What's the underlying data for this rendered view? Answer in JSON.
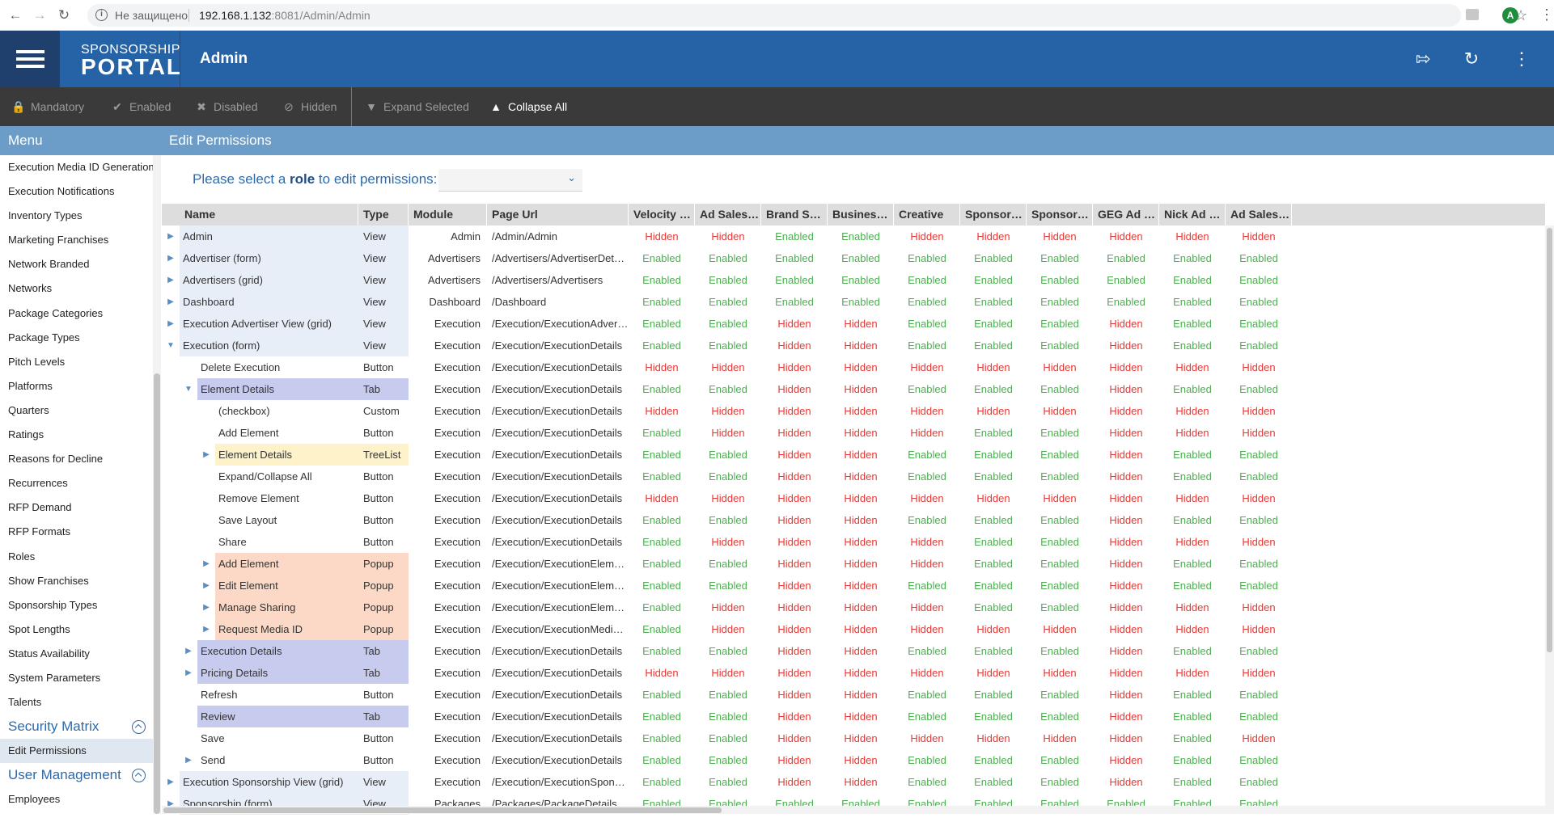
{
  "browser": {
    "insecure_label": "Не защищено",
    "url_host": "192.168.1.132",
    "url_rest": ":8081/Admin/Admin",
    "profile_initial": "A"
  },
  "header": {
    "logo_line1": "SPONSORSHIP",
    "logo_line2": "PORTAL",
    "title": "Admin",
    "brand_color": "#2563a6"
  },
  "toolbar": {
    "mandatory": "Mandatory",
    "enabled": "Enabled",
    "disabled": "Disabled",
    "hidden": "Hidden",
    "expand_selected": "Expand Selected",
    "collapse_all": "Collapse All"
  },
  "menu": {
    "title": "Menu",
    "items": [
      {
        "label": "Execution Media ID Generation"
      },
      {
        "label": "Execution Notifications"
      },
      {
        "label": "Inventory Types"
      },
      {
        "label": "Marketing Franchises"
      },
      {
        "label": "Network Branded"
      },
      {
        "label": "Networks"
      },
      {
        "label": "Package Categories"
      },
      {
        "label": "Package Types"
      },
      {
        "label": "Pitch Levels"
      },
      {
        "label": "Platforms"
      },
      {
        "label": "Quarters"
      },
      {
        "label": "Ratings"
      },
      {
        "label": "Reasons for Decline"
      },
      {
        "label": "Recurrences"
      },
      {
        "label": "RFP Demand"
      },
      {
        "label": "RFP Formats"
      },
      {
        "label": "Roles"
      },
      {
        "label": "Show Franchises"
      },
      {
        "label": "Sponsorship Types"
      },
      {
        "label": "Spot Lengths"
      },
      {
        "label": "Status Availability"
      },
      {
        "label": "System Parameters"
      },
      {
        "label": "Talents"
      },
      {
        "label": "Security Matrix",
        "section": true
      },
      {
        "label": "Edit Permissions",
        "selected": true
      },
      {
        "label": "User Management",
        "section": true
      },
      {
        "label": "Employees"
      }
    ]
  },
  "content": {
    "title": "Edit Permissions",
    "role_prompt_prefix": "Please select a ",
    "role_prompt_bold": "role",
    "role_prompt_suffix": " to edit permissions:",
    "role_value": ""
  },
  "grid": {
    "columns": [
      "Name",
      "Type",
      "Module",
      "Page Url",
      "Velocity Ex...",
      "Ad Sales A...",
      "Brand Sales",
      "Business A...",
      "Creative",
      "Sponsorshi...",
      "Sponsorshi...",
      "GEG Ad Sal...",
      "Nick Ad Sal...",
      "Ad Sales SSE"
    ],
    "colors": {
      "enabled": "#4caf50",
      "hidden": "#e53935"
    },
    "rows": [
      {
        "name": "Admin",
        "type": "View",
        "module": "Admin",
        "url": "/Admin/Admin",
        "level": 0,
        "expander": "right",
        "hl": "view",
        "perms": [
          "Hidden",
          "Hidden",
          "Enabled",
          "Enabled",
          "Hidden",
          "Hidden",
          "Hidden",
          "Hidden",
          "Hidden",
          "Hidden"
        ]
      },
      {
        "name": "Advertiser (form)",
        "type": "View",
        "module": "Advertisers",
        "url": "/Advertisers/AdvertiserDetails",
        "level": 0,
        "expander": "right",
        "hl": "view",
        "perms": [
          "Enabled",
          "Enabled",
          "Enabled",
          "Enabled",
          "Enabled",
          "Enabled",
          "Enabled",
          "Enabled",
          "Enabled",
          "Enabled"
        ]
      },
      {
        "name": "Advertisers (grid)",
        "type": "View",
        "module": "Advertisers",
        "url": "/Advertisers/Advertisers",
        "level": 0,
        "expander": "right",
        "hl": "view",
        "perms": [
          "Enabled",
          "Enabled",
          "Enabled",
          "Enabled",
          "Enabled",
          "Enabled",
          "Enabled",
          "Enabled",
          "Enabled",
          "Enabled"
        ]
      },
      {
        "name": "Dashboard",
        "type": "View",
        "module": "Dashboard",
        "url": "/Dashboard",
        "level": 0,
        "expander": "right",
        "hl": "view",
        "perms": [
          "Enabled",
          "Enabled",
          "Enabled",
          "Enabled",
          "Enabled",
          "Enabled",
          "Enabled",
          "Enabled",
          "Enabled",
          "Enabled"
        ]
      },
      {
        "name": "Execution Advertiser View (grid)",
        "type": "View",
        "module": "Execution",
        "url": "/Execution/ExecutionAdvertiser",
        "level": 0,
        "expander": "right",
        "hl": "view",
        "perms": [
          "Enabled",
          "Enabled",
          "Hidden",
          "Hidden",
          "Enabled",
          "Enabled",
          "Enabled",
          "Hidden",
          "Enabled",
          "Enabled"
        ]
      },
      {
        "name": "Execution (form)",
        "type": "View",
        "module": "Execution",
        "url": "/Execution/ExecutionDetails",
        "level": 0,
        "expander": "down",
        "hl": "view",
        "perms": [
          "Enabled",
          "Enabled",
          "Hidden",
          "Hidden",
          "Enabled",
          "Enabled",
          "Enabled",
          "Hidden",
          "Enabled",
          "Enabled"
        ]
      },
      {
        "name": "Delete Execution",
        "type": "Button",
        "module": "Execution",
        "url": "/Execution/ExecutionDetails",
        "level": 1,
        "expander": "",
        "hl": "",
        "perms": [
          "Hidden",
          "Hidden",
          "Hidden",
          "Hidden",
          "Hidden",
          "Hidden",
          "Hidden",
          "Hidden",
          "Hidden",
          "Hidden"
        ]
      },
      {
        "name": "Element Details",
        "type": "Tab",
        "module": "Execution",
        "url": "/Execution/ExecutionDetails",
        "level": 1,
        "expander": "down",
        "hl": "tab",
        "perms": [
          "Enabled",
          "Enabled",
          "Hidden",
          "Hidden",
          "Enabled",
          "Enabled",
          "Enabled",
          "Hidden",
          "Enabled",
          "Enabled"
        ]
      },
      {
        "name": "(checkbox)",
        "type": "Custom",
        "module": "Execution",
        "url": "/Execution/ExecutionDetails",
        "level": 2,
        "expander": "",
        "hl": "",
        "perms": [
          "Hidden",
          "Hidden",
          "Hidden",
          "Hidden",
          "Hidden",
          "Hidden",
          "Hidden",
          "Hidden",
          "Hidden",
          "Hidden"
        ]
      },
      {
        "name": "Add Element",
        "type": "Button",
        "module": "Execution",
        "url": "/Execution/ExecutionDetails",
        "level": 2,
        "expander": "",
        "hl": "",
        "perms": [
          "Enabled",
          "Hidden",
          "Hidden",
          "Hidden",
          "Hidden",
          "Enabled",
          "Enabled",
          "Hidden",
          "Hidden",
          "Hidden"
        ]
      },
      {
        "name": "Element Details",
        "type": "TreeList",
        "module": "Execution",
        "url": "/Execution/ExecutionDetails",
        "level": 2,
        "expander": "right",
        "hl": "tree",
        "perms": [
          "Enabled",
          "Enabled",
          "Hidden",
          "Hidden",
          "Enabled",
          "Enabled",
          "Enabled",
          "Hidden",
          "Enabled",
          "Enabled"
        ]
      },
      {
        "name": "Expand/Collapse All",
        "type": "Button",
        "module": "Execution",
        "url": "/Execution/ExecutionDetails",
        "level": 2,
        "expander": "",
        "hl": "",
        "perms": [
          "Enabled",
          "Enabled",
          "Hidden",
          "Hidden",
          "Enabled",
          "Enabled",
          "Enabled",
          "Hidden",
          "Enabled",
          "Enabled"
        ]
      },
      {
        "name": "Remove Element",
        "type": "Button",
        "module": "Execution",
        "url": "/Execution/ExecutionDetails",
        "level": 2,
        "expander": "",
        "hl": "",
        "perms": [
          "Hidden",
          "Hidden",
          "Hidden",
          "Hidden",
          "Hidden",
          "Hidden",
          "Hidden",
          "Hidden",
          "Hidden",
          "Hidden"
        ]
      },
      {
        "name": "Save Layout",
        "type": "Button",
        "module": "Execution",
        "url": "/Execution/ExecutionDetails",
        "level": 2,
        "expander": "",
        "hl": "",
        "perms": [
          "Enabled",
          "Enabled",
          "Hidden",
          "Hidden",
          "Enabled",
          "Enabled",
          "Enabled",
          "Hidden",
          "Enabled",
          "Enabled"
        ]
      },
      {
        "name": "Share",
        "type": "Button",
        "module": "Execution",
        "url": "/Execution/ExecutionDetails",
        "level": 2,
        "expander": "",
        "hl": "",
        "perms": [
          "Enabled",
          "Hidden",
          "Hidden",
          "Hidden",
          "Hidden",
          "Enabled",
          "Enabled",
          "Hidden",
          "Hidden",
          "Hidden"
        ]
      },
      {
        "name": "Add Element",
        "type": "Popup",
        "module": "Execution",
        "url": "/Execution/ExecutionElements...",
        "level": 2,
        "expander": "right",
        "hl": "popup",
        "perms": [
          "Enabled",
          "Enabled",
          "Hidden",
          "Hidden",
          "Hidden",
          "Enabled",
          "Enabled",
          "Hidden",
          "Enabled",
          "Enabled"
        ]
      },
      {
        "name": "Edit Element",
        "type": "Popup",
        "module": "Execution",
        "url": "/Execution/ExecutionElements...",
        "level": 2,
        "expander": "right",
        "hl": "popup",
        "perms": [
          "Enabled",
          "Enabled",
          "Hidden",
          "Hidden",
          "Enabled",
          "Enabled",
          "Enabled",
          "Hidden",
          "Enabled",
          "Enabled"
        ]
      },
      {
        "name": "Manage Sharing",
        "type": "Popup",
        "module": "Execution",
        "url": "/Execution/ExecutionElements...",
        "level": 2,
        "expander": "right",
        "hl": "popup",
        "perms": [
          "Enabled",
          "Hidden",
          "Hidden",
          "Hidden",
          "Hidden",
          "Enabled",
          "Enabled",
          "Hidden",
          "Hidden",
          "Hidden"
        ]
      },
      {
        "name": "Request Media ID",
        "type": "Popup",
        "module": "Execution",
        "url": "/Execution/ExecutionMediaRe...",
        "level": 2,
        "expander": "right",
        "hl": "popup",
        "perms": [
          "Enabled",
          "Hidden",
          "Hidden",
          "Hidden",
          "Hidden",
          "Hidden",
          "Hidden",
          "Hidden",
          "Hidden",
          "Hidden"
        ]
      },
      {
        "name": "Execution Details",
        "type": "Tab",
        "module": "Execution",
        "url": "/Execution/ExecutionDetails",
        "level": 1,
        "expander": "right",
        "hl": "tab",
        "perms": [
          "Enabled",
          "Enabled",
          "Hidden",
          "Hidden",
          "Enabled",
          "Enabled",
          "Enabled",
          "Hidden",
          "Enabled",
          "Enabled"
        ]
      },
      {
        "name": "Pricing Details",
        "type": "Tab",
        "module": "Execution",
        "url": "/Execution/ExecutionDetails",
        "level": 1,
        "expander": "right",
        "hl": "tab",
        "perms": [
          "Hidden",
          "Hidden",
          "Hidden",
          "Hidden",
          "Hidden",
          "Hidden",
          "Hidden",
          "Hidden",
          "Hidden",
          "Hidden"
        ]
      },
      {
        "name": "Refresh",
        "type": "Button",
        "module": "Execution",
        "url": "/Execution/ExecutionDetails",
        "level": 1,
        "expander": "",
        "hl": "",
        "perms": [
          "Enabled",
          "Enabled",
          "Hidden",
          "Hidden",
          "Enabled",
          "Enabled",
          "Enabled",
          "Hidden",
          "Enabled",
          "Enabled"
        ]
      },
      {
        "name": "Review",
        "type": "Tab",
        "module": "Execution",
        "url": "/Execution/ExecutionDetails",
        "level": 1,
        "expander": "",
        "hl": "tab",
        "perms": [
          "Enabled",
          "Enabled",
          "Hidden",
          "Hidden",
          "Enabled",
          "Enabled",
          "Enabled",
          "Hidden",
          "Enabled",
          "Enabled"
        ]
      },
      {
        "name": "Save",
        "type": "Button",
        "module": "Execution",
        "url": "/Execution/ExecutionDetails",
        "level": 1,
        "expander": "",
        "hl": "",
        "perms": [
          "Enabled",
          "Enabled",
          "Hidden",
          "Hidden",
          "Hidden",
          "Hidden",
          "Hidden",
          "Hidden",
          "Enabled",
          "Hidden"
        ]
      },
      {
        "name": "Send",
        "type": "Button",
        "module": "Execution",
        "url": "/Execution/ExecutionDetails",
        "level": 1,
        "expander": "right",
        "hl": "",
        "perms": [
          "Enabled",
          "Enabled",
          "Hidden",
          "Hidden",
          "Enabled",
          "Enabled",
          "Enabled",
          "Hidden",
          "Enabled",
          "Enabled"
        ]
      },
      {
        "name": "Execution Sponsorship View (grid)",
        "type": "View",
        "module": "Execution",
        "url": "/Execution/ExecutionSponsors...",
        "level": 0,
        "expander": "right",
        "hl": "view",
        "perms": [
          "Enabled",
          "Enabled",
          "Hidden",
          "Hidden",
          "Enabled",
          "Enabled",
          "Enabled",
          "Hidden",
          "Enabled",
          "Enabled"
        ]
      },
      {
        "name": "Sponsorship (form)",
        "type": "View",
        "module": "Packages",
        "url": "/Packages/PackageDetails",
        "level": 0,
        "expander": "right",
        "hl": "view",
        "perms": [
          "Enabled",
          "Enabled",
          "Enabled",
          "Enabled",
          "Enabled",
          "Enabled",
          "Enabled",
          "Enabled",
          "Enabled",
          "Enabled"
        ]
      }
    ]
  }
}
